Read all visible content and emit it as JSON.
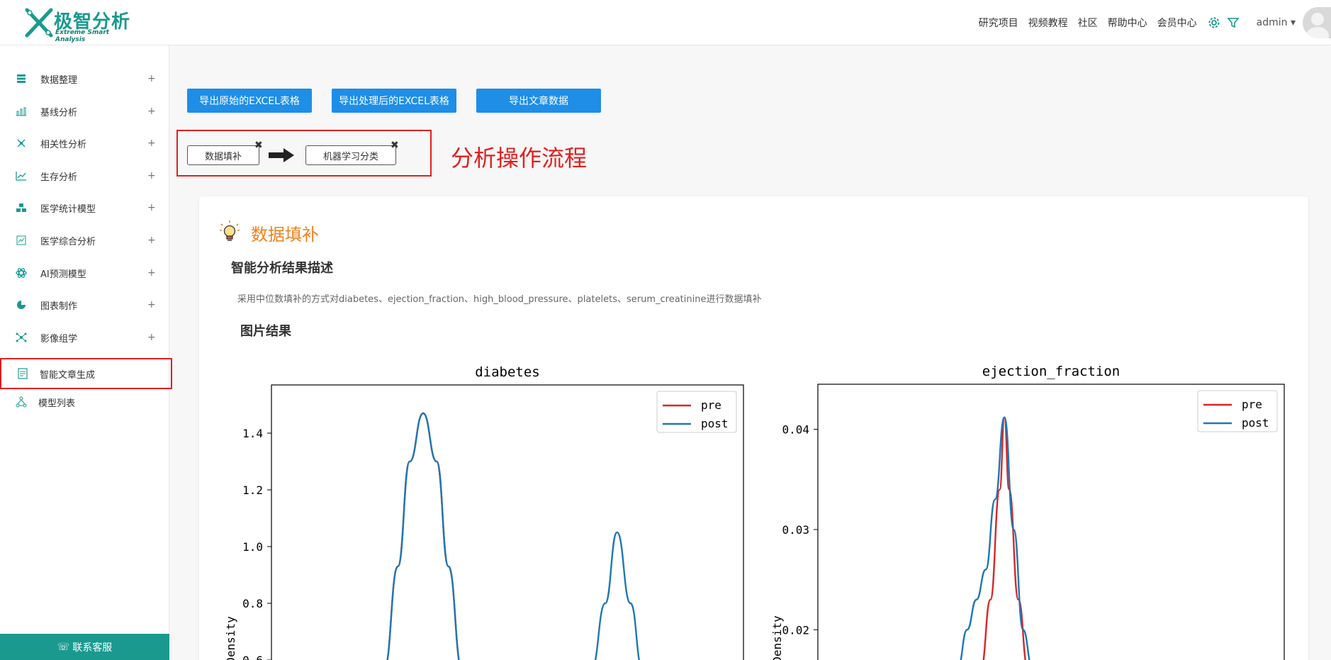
{
  "header": {
    "logo_cn": "极智分析",
    "logo_en": "Extreme Smart Analysis",
    "nav": [
      "研究项目",
      "视频教程",
      "社区",
      "帮助中心",
      "会员中心"
    ],
    "user": "admin"
  },
  "sidebar": {
    "items": [
      {
        "label": "数据整理",
        "icon": "database-icon",
        "plus": "+"
      },
      {
        "label": "基线分析",
        "icon": "bar-chart-icon",
        "plus": "+"
      },
      {
        "label": "相关性分析",
        "icon": "correlation-icon",
        "plus": "+"
      },
      {
        "label": "生存分析",
        "icon": "line-chart-icon",
        "plus": "+"
      },
      {
        "label": "医学统计模型",
        "icon": "cubes-icon",
        "plus": "+"
      },
      {
        "label": "医学综合分析",
        "icon": "trend-icon",
        "plus": "+"
      },
      {
        "label": "AI预测模型",
        "icon": "atom-icon",
        "plus": "+"
      },
      {
        "label": "图表制作",
        "icon": "pie-chart-icon",
        "plus": "+"
      },
      {
        "label": "影像组学",
        "icon": "network-icon",
        "plus": "+"
      }
    ],
    "article": {
      "label": "智能文章生成",
      "icon": "document-icon"
    },
    "model_list": {
      "label": "模型列表",
      "icon": "hierarchy-icon"
    },
    "contact": "联系客服"
  },
  "toolbar": {
    "export_raw": "导出原始的EXCEL表格",
    "export_processed": "导出处理后的EXCEL表格",
    "export_article": "导出文章数据"
  },
  "flow": {
    "steps": [
      "数据填补",
      "机器学习分类"
    ],
    "close": "✖",
    "title": "分析操作流程"
  },
  "section": {
    "title": "数据填补",
    "subtitle": "智能分析结果描述",
    "description": "采用中位数填补的方式对diabetes、ejection_fraction、high_blood_pressure、platelets、serum_creatinine进行数据填补",
    "images_title": "图片结果"
  },
  "colors": {
    "accent": "#1a9a8f",
    "button": "#1e8ee6",
    "highlight": "#e02020",
    "section_title": "#f0821e",
    "pre": "#d62728",
    "post": "#1f77b4"
  },
  "chart_data": [
    {
      "type": "line",
      "title": "diabetes",
      "ylabel": "Density",
      "ylim": [
        0.57,
        1.57
      ],
      "yticks": [
        0.6,
        0.8,
        1.0,
        1.2,
        1.4
      ],
      "ytick_labels": [
        "0.6",
        "0.8",
        "1.0",
        "1.2",
        "1.4"
      ],
      "xlim": [
        -0.9,
        1.9
      ],
      "legend": "top-right",
      "series": [
        {
          "name": "pre",
          "color": "#d62728",
          "x": [
            -0.23,
            -0.15,
            -0.08,
            0.0,
            0.08,
            0.15,
            0.23
          ],
          "y": [
            0.57,
            0.93,
            1.3,
            1.47,
            1.3,
            0.93,
            0.57
          ]
        },
        {
          "name": "post",
          "color": "#1f77b4",
          "x": [
            -0.23,
            -0.15,
            -0.08,
            0.0,
            0.08,
            0.15,
            0.23,
            1.0,
            1.08,
            1.15,
            1.23,
            1.3
          ],
          "y": [
            0.57,
            0.93,
            1.3,
            1.47,
            1.3,
            0.93,
            0.57,
            0.57,
            0.8,
            1.05,
            0.8,
            0.57
          ]
        }
      ]
    },
    {
      "type": "line",
      "title": "ejection_fraction",
      "ylabel": "Density",
      "ylim": [
        0.0162,
        0.0445
      ],
      "yticks": [
        0.02,
        0.03,
        0.04
      ],
      "ytick_labels": [
        "0.02",
        "0.03",
        "0.04"
      ],
      "xlim": [
        -5,
        95
      ],
      "legend": "top-right",
      "series": [
        {
          "name": "pre",
          "color": "#d62728",
          "x": [
            30,
            32,
            34,
            35,
            36,
            38,
            40
          ],
          "y": [
            0.0162,
            0.023,
            0.034,
            0.0412,
            0.034,
            0.023,
            0.0162
          ]
        },
        {
          "name": "post",
          "color": "#1f77b4",
          "x": [
            25,
            27,
            29,
            31,
            33,
            35,
            37,
            39,
            41
          ],
          "y": [
            0.0162,
            0.02,
            0.023,
            0.026,
            0.033,
            0.0412,
            0.03,
            0.02,
            0.0162
          ]
        }
      ]
    }
  ]
}
